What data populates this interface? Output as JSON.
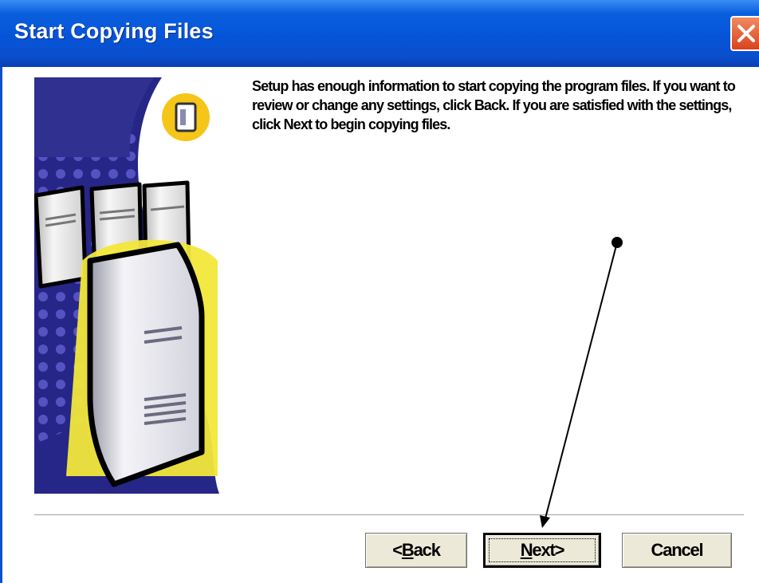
{
  "window": {
    "title": "Start Copying Files",
    "close_icon": "close-icon"
  },
  "main": {
    "message": "Setup has enough information to start copying the program files. If you want to review or change any settings, click Back.  If you are satisfied with the settings, click Next to begin copying files.",
    "illustration": "server-computers-illustration"
  },
  "buttons": {
    "back": {
      "prefix": "< ",
      "accel": "B",
      "rest": "ack"
    },
    "next": {
      "accel": "N",
      "rest": "ext",
      "suffix": " >"
    },
    "cancel": "Cancel"
  },
  "annotation": {
    "type": "arrow",
    "target": "next-button"
  },
  "colors": {
    "titlebar": "#0554d8",
    "close_button": "#e05a30",
    "illustration_blue": "#2a2a8a",
    "illustration_glow": "#f2e73a"
  }
}
